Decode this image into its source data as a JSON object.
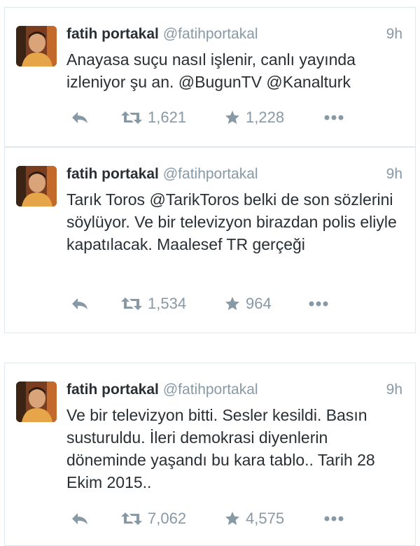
{
  "tweets": [
    {
      "name": "fatih portakal",
      "handle": "@fatihportakal",
      "time": "9h",
      "text": "Anayasa suçu nasıl işlenir, canlı yayında izleniyor şu an. @BugunTV @Kanalturk",
      "retweets": "1,621",
      "favorites": "1,228"
    },
    {
      "name": "fatih portakal",
      "handle": "@fatihportakal",
      "time": "9h",
      "text": "Tarık Toros @TarikToros belki de son sözlerini söylüyor. Ve bir televizyon birazdan polis eliyle kapatılacak. Maalesef TR gerçeği",
      "retweets": "1,534",
      "favorites": "964"
    },
    {
      "name": "fatih portakal",
      "handle": "@fatihportakal",
      "time": "9h",
      "text": "Ve bir televizyon bitti. Sesler kesildi. Basın susturuldu. İleri demokrasi diyenlerin döneminde yaşandı bu kara tablo.. Tarih 28 Ekim 2015..",
      "retweets": "7,062",
      "favorites": "4,575"
    }
  ],
  "icons": {
    "reply": "reply-icon",
    "retweet": "retweet-icon",
    "favorite": "star-icon",
    "more": "more-icon"
  },
  "colors": {
    "text": "#292f33",
    "muted": "#8899a6",
    "border": "#e1e8ed"
  }
}
